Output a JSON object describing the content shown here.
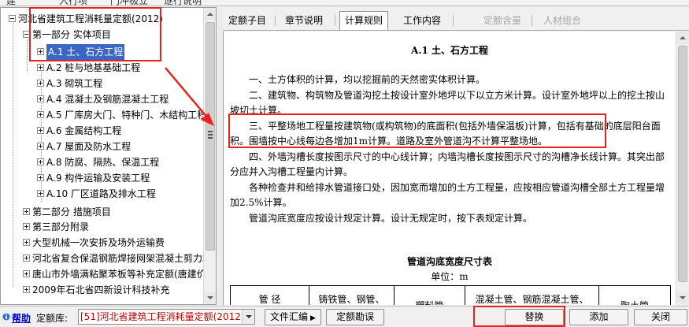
{
  "toolbar_partial": [
    "建",
    "入行项",
    "门冲极立",
    "逐行说明"
  ],
  "tree": {
    "root": "河北省建筑工程消耗量定额(2012)",
    "part1": "第一部分 实体项目",
    "chapters": [
      "A.1 土、石方工程",
      "A.2 桩与地基基础工程",
      "A.3 砌筑工程",
      "A.4 混凝土及钢筋混凝土工程",
      "A.5 厂库房大门、特种门、木结构工程",
      "A.6 金属结构工程",
      "A.7 屋面及防水工程",
      "A.8 防腐、隔热、保温工程",
      "A.9 构件运输及安装工程",
      "A.10 厂区道路及排水工程"
    ],
    "part2": "第二部分 措施项目",
    "part3": "第三部分附录",
    "others": [
      "大型机械一次安拆及场外运输费",
      "河北省复合保温钢筋焊接网架混凝土剪力墙",
      "唐山市外墙满粘聚苯板等补充定额(唐建价",
      "2009年石北省四新设计科技补充"
    ]
  },
  "tabs": {
    "quota_sub": "定额子目",
    "chapter_desc": "章节说明",
    "calc_rules": "计算规则",
    "work_content": "工作内容",
    "quota_content": "定额含量",
    "material_combo": "人材组合"
  },
  "doc": {
    "title": "A.1 土、石方工程",
    "p1": "一、土方体积的计算，均以挖掘前的天然密实体积计算。",
    "p2": "二、建筑物、构筑物及管道沟挖土按设计室外地坪以下以立方米计算。设计室外地坪以上的挖土按山坡切土计算。",
    "p3": "三、平整场地工程量按建筑物(或构筑物)的底面积(包括外墙保温板)计算，包括有基础的底层阳台面积。围墙按中心线每边各增加1m计算。道路及室外管道沟不计算平整场地。",
    "p4": "四、外墙沟槽长度按图示尺寸的中心线计算；内墙沟槽长度按图示尺寸的沟槽净长线计算。其突出部分应并入沟槽工程量内计算。",
    "p5": "各种检查井和给排水管道接口处，因加宽而增加的土方工程量，应按相应管道沟槽全部土方工程量增加2.5%计算。",
    "p6": "管道沟底宽度应按设计规定计算。设计无规定时，按下表规定计算。",
    "table_title": "管道沟底宽度尺寸表",
    "unit": "单位：m",
    "table_headers": [
      "管 径\n(mm)",
      "铸铁管、钢管、\n石棉水泥管",
      "塑料管",
      "混凝土管、钢筋混凝土管、\n预应力钢筋混凝土管",
      "陶土管"
    ]
  },
  "bottom": {
    "help": "帮助",
    "lib_label": "定额库:",
    "lib_value": "[51]河北省建筑工程消耗量定额(2012)",
    "file_collect": "文件汇编",
    "quota_errata": "定额勘误",
    "replace": "替换",
    "add": "添加",
    "close": "关闭"
  },
  "colors": {
    "selection": "#3a67c4",
    "annotation": "#e8221d",
    "library_text": "#c00000",
    "link": "#0000cc"
  }
}
